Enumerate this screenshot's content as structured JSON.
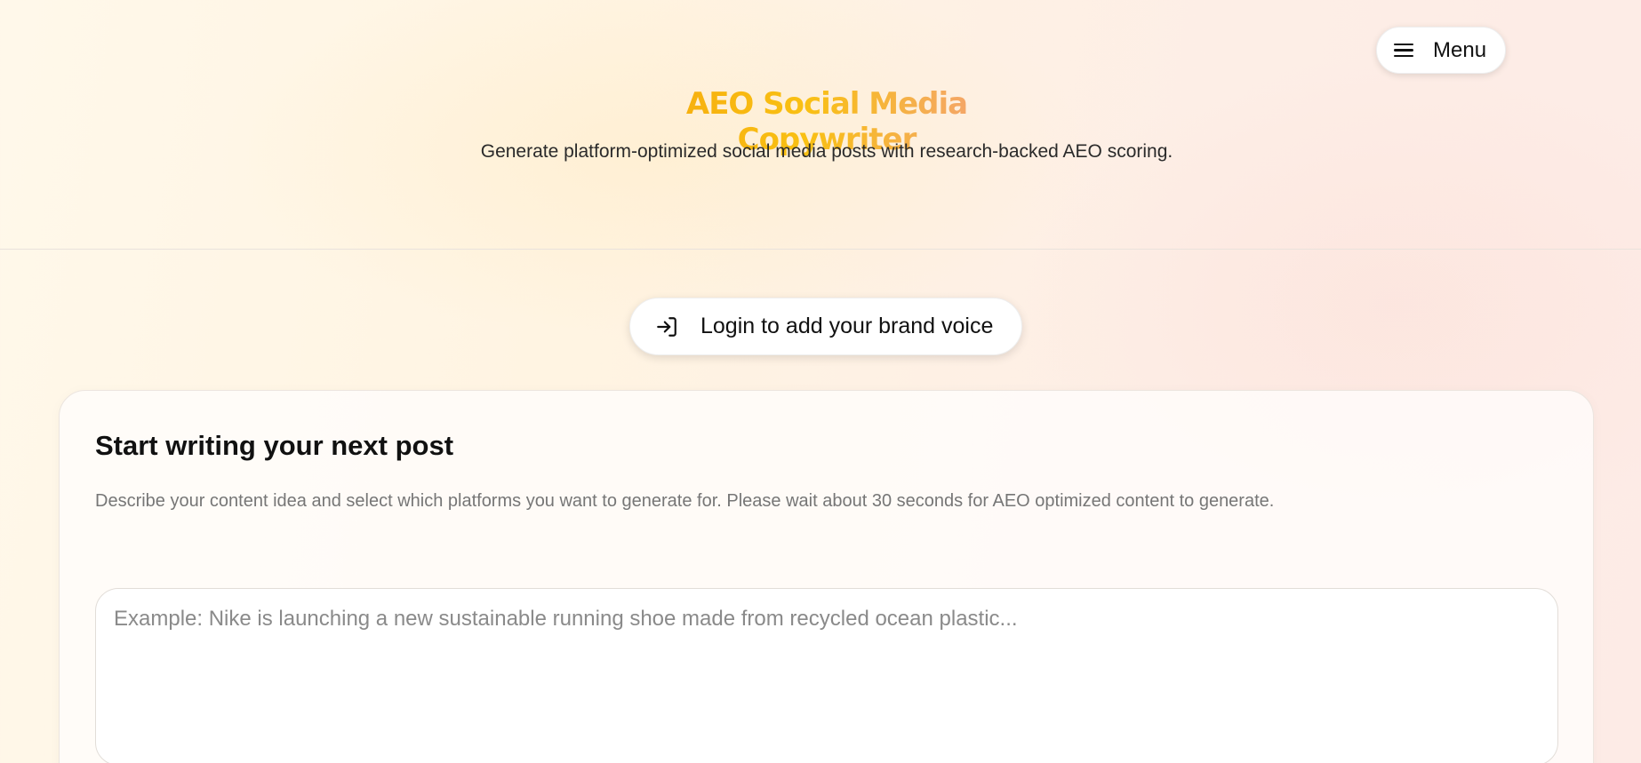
{
  "header": {
    "menu_label": "Menu",
    "title": "AEO Social Media Copywriter",
    "subtitle": "Generate platform-optimized social media posts with research-backed AEO scoring."
  },
  "login": {
    "label": "Login to add your brand voice"
  },
  "composer": {
    "heading": "Start writing your next post",
    "description": "Describe your content idea and select which platforms you want to generate for. Please wait about 30 seconds for AEO optimized content to generate.",
    "input_value": "",
    "input_placeholder": "Example: Nike is launching a new sustainable running shoe made from recycled ocean plastic..."
  },
  "icons": {
    "menu": "hamburger-menu-icon",
    "login": "login-arrow-icon"
  },
  "colors": {
    "title_gradient_start": "#f5a80d",
    "title_gradient_mid": "#f9c013",
    "title_gradient_end": "#f49a8a",
    "background": "#fff4e2"
  }
}
